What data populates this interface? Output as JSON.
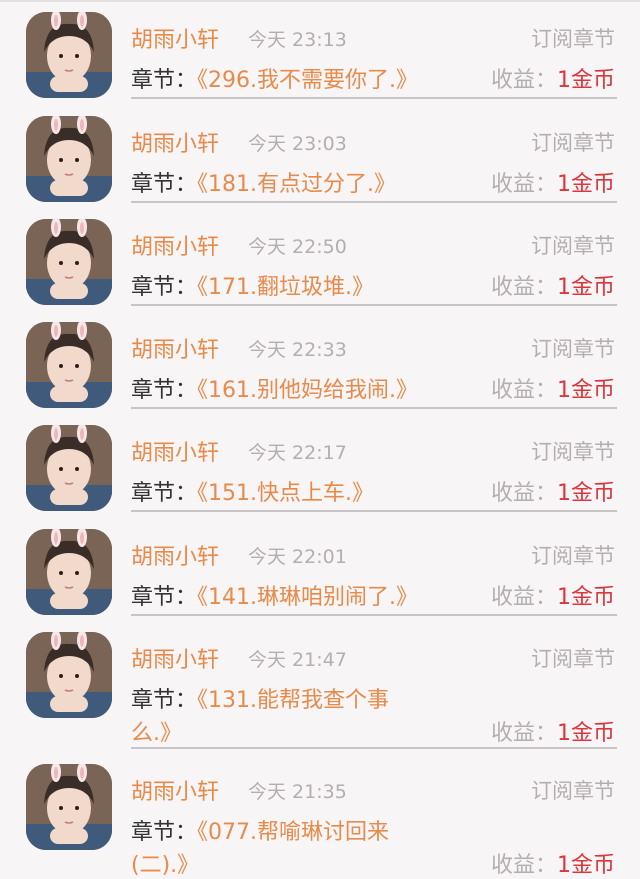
{
  "labels": {
    "chapter_prefix": "章节：",
    "income_prefix": "收益：",
    "action": "订阅章节"
  },
  "colors": {
    "accent": "#e88a4a",
    "income": "#d9363e",
    "muted": "#b4aeb1",
    "background": "#f7f5f6"
  },
  "records": [
    {
      "user": "胡雨小轩",
      "time": "今天 23:13",
      "chapter": "《296.我不需要你了.》",
      "chapter_cont": "",
      "income": "1金币"
    },
    {
      "user": "胡雨小轩",
      "time": "今天 23:03",
      "chapter": "《181.有点过分了.》",
      "chapter_cont": "",
      "income": "1金币"
    },
    {
      "user": "胡雨小轩",
      "time": "今天 22:50",
      "chapter": "《171.翻垃圾堆.》",
      "chapter_cont": "",
      "income": "1金币"
    },
    {
      "user": "胡雨小轩",
      "time": "今天 22:33",
      "chapter": "《161.别他妈给我闹.》",
      "chapter_cont": "",
      "income": "1金币"
    },
    {
      "user": "胡雨小轩",
      "time": "今天 22:17",
      "chapter": "《151.快点上车.》",
      "chapter_cont": "",
      "income": "1金币"
    },
    {
      "user": "胡雨小轩",
      "time": "今天 22:01",
      "chapter": "《141.琳琳咱别闹了.》",
      "chapter_cont": "",
      "income": "1金币"
    },
    {
      "user": "胡雨小轩",
      "time": "今天 21:47",
      "chapter": "《131.能帮我查个事",
      "chapter_cont": "么.》",
      "income": "1金币"
    },
    {
      "user": "胡雨小轩",
      "time": "今天 21:35",
      "chapter": "《077.帮喻琳讨回来",
      "chapter_cont": "(二).》",
      "income": "1金币"
    }
  ]
}
